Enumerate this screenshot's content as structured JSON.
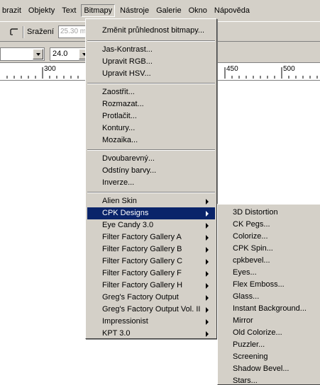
{
  "menubar": {
    "items": [
      {
        "label": "brazit",
        "active": false
      },
      {
        "label": "Objekty",
        "active": false
      },
      {
        "label": "Text",
        "active": false
      },
      {
        "label": "Bitmapy",
        "active": true
      },
      {
        "label": "Nástroje",
        "active": false
      },
      {
        "label": "Galerie",
        "active": false
      },
      {
        "label": "Okno",
        "active": false
      },
      {
        "label": "Nápověda",
        "active": false
      }
    ]
  },
  "toolbar": {
    "srazeni_label": "Sražení",
    "srazeni_value": "25.30 mm",
    "size_value": "24.0"
  },
  "ruler": {
    "labels": [
      "300",
      "450",
      "500"
    ]
  },
  "bitmap_menu": {
    "items": [
      {
        "label": "Změnit průhlednost bitmapy...",
        "has_sub": false
      },
      {
        "label": "Jas-Kontrast...",
        "has_sub": false
      },
      {
        "label": "Upravit RGB...",
        "has_sub": false
      },
      {
        "label": "Upravit HSV...",
        "has_sub": false
      },
      {
        "label": "Zaostřit...",
        "has_sub": false
      },
      {
        "label": "Rozmazat...",
        "has_sub": false
      },
      {
        "label": "Protlačit...",
        "has_sub": false
      },
      {
        "label": "Kontury...",
        "has_sub": false
      },
      {
        "label": "Mozaika...",
        "has_sub": false
      },
      {
        "label": "Dvoubarevný...",
        "has_sub": false
      },
      {
        "label": "Odstíny barvy...",
        "has_sub": false
      },
      {
        "label": "Inverze...",
        "has_sub": false
      },
      {
        "label": "Alien Skin",
        "has_sub": true
      },
      {
        "label": "CPK Designs",
        "has_sub": true
      },
      {
        "label": "Eye Candy 3.0",
        "has_sub": true
      },
      {
        "label": "Filter Factory Gallery A",
        "has_sub": true
      },
      {
        "label": "Filter Factory Gallery B",
        "has_sub": true
      },
      {
        "label": "Filter Factory Gallery C",
        "has_sub": true
      },
      {
        "label": "Filter Factory Gallery F",
        "has_sub": true
      },
      {
        "label": "Filter Factory Gallery H",
        "has_sub": true
      },
      {
        "label": "Greg's Factory Output",
        "has_sub": true
      },
      {
        "label": "Greg's Factory Output Vol. II",
        "has_sub": true
      },
      {
        "label": "Impressionist",
        "has_sub": true
      },
      {
        "label": "KPT 3.0",
        "has_sub": true
      }
    ],
    "highlighted": "CPK Designs"
  },
  "cpk_submenu": {
    "items": [
      "3D Distortion",
      "CK Pegs...",
      "Colorize...",
      "CPK Spin...",
      "cpkbevel...",
      "Eyes...",
      "Flex Emboss...",
      "Glass...",
      "Instant Background...",
      "Mirror",
      "Old Colorize...",
      "Puzzler...",
      "Screening",
      "Shadow Bevel...",
      "Stars..."
    ]
  },
  "colors": {
    "face": "#d4d0c8",
    "highlight": "#0a246a",
    "shadow": "#808080"
  }
}
